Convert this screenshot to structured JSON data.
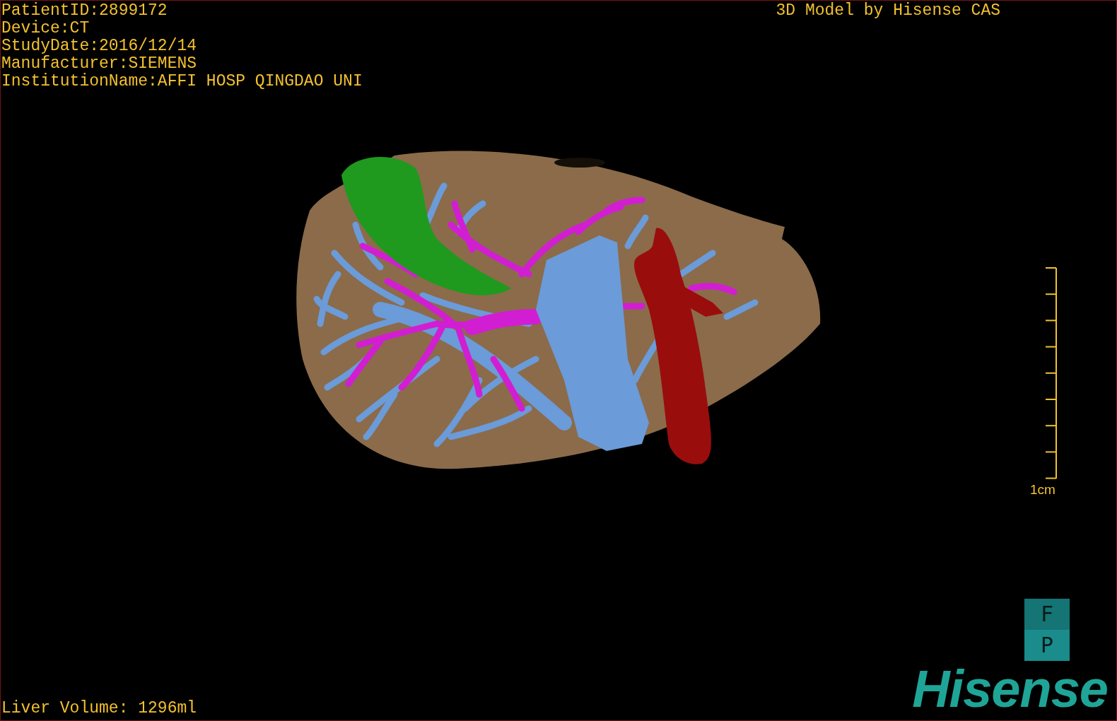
{
  "patient_info": [
    "PatientID:2899172",
    "Device:CT",
    "StudyDate:2016/12/14",
    "Manufacturer:SIEMENS",
    "InstitutionName:AFFI HOSP QINGDAO UNI"
  ],
  "brand_label": "3D Model by Hisense CAS",
  "scale_bar": {
    "label": "1cm"
  },
  "orientation_buttons": [
    {
      "label": "F"
    },
    {
      "label": "P"
    }
  ],
  "logo": "Hisense",
  "liver_volume": "Liver Volume: 1296ml"
}
